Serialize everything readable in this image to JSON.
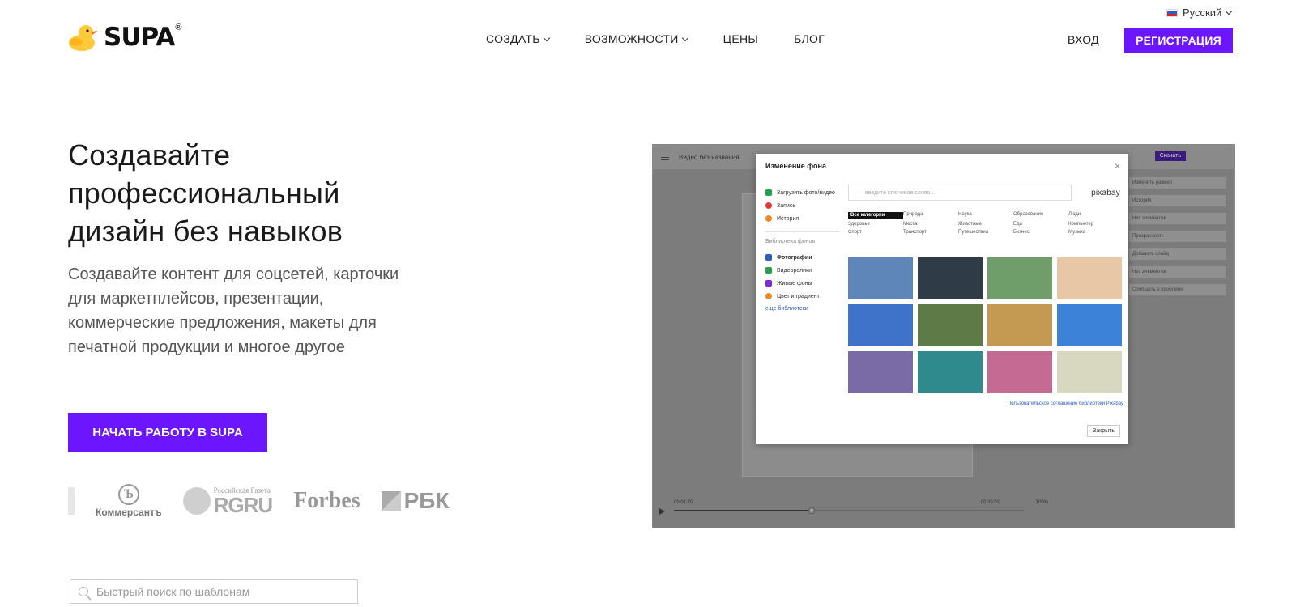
{
  "header": {
    "language": "Русский",
    "logo_text": "SUPA",
    "logo_reg": "®",
    "nav": [
      {
        "label": "СОЗДАТЬ",
        "dropdown": true
      },
      {
        "label": "ВОЗМОЖНОСТИ",
        "dropdown": true
      },
      {
        "label": "ЦЕНЫ",
        "dropdown": false
      },
      {
        "label": "БЛОГ",
        "dropdown": false
      }
    ],
    "login": "ВХОД",
    "register": "РЕГИСТРАЦИЯ"
  },
  "hero": {
    "title_lines": [
      "Создавайте",
      "профессиональный",
      "дизайн без навыков"
    ],
    "subtitle": "Создавайте контент для соцсетей, карточки для маркетплейсов, презентации, коммерческие предложения, макеты для печатной продукции и многое другое",
    "cta": "НАЧАТЬ РАБОТУ В SUPA"
  },
  "press": {
    "kommersant": "Коммерсантъ",
    "kommersant_mark": "Ъ",
    "rg_small": "Российская Газета",
    "rg_big": "RGRU",
    "forbes": "Forbes",
    "rbk": "РБК"
  },
  "search": {
    "placeholder": "Быстрый поиск по шаблонам"
  },
  "editor": {
    "doc_title": "Видео без названия",
    "download": "Скачать",
    "right_panel": [
      "Изменить размер",
      "История",
      "Нет элементов",
      "Прозрачность",
      "Добавить слайд",
      "Нет элементов",
      "Сообщить о проблеме"
    ],
    "time_start": "00:01:70",
    "time_end": "00:35:02",
    "volume": "100%",
    "modal": {
      "title": "Изменение фона",
      "close_x": "×",
      "actions": [
        {
          "label": "Загрузить фото/видео",
          "color": "#22a04b"
        },
        {
          "label": "Запись",
          "color": "#e53935"
        },
        {
          "label": "История",
          "color": "#f08a24"
        }
      ],
      "library_title": "Библиотека фонов",
      "library": [
        {
          "label": "Фотографии",
          "color": "#2a5fc4"
        },
        {
          "label": "Видеоролики",
          "color": "#22a04b"
        },
        {
          "label": "Живые фоны",
          "color": "#7b2bd6"
        },
        {
          "label": "Цвет и градиент",
          "color": "#f08a24"
        }
      ],
      "more_libraries": "еще библиотеки",
      "search_placeholder": "введите ключевое слово...",
      "provider": "pixabay",
      "categories": [
        "Все категории",
        "Природа",
        "Наука",
        "Образование",
        "Люди",
        "Здоровье",
        "Места",
        "Животные",
        "Еда",
        "Компьютер",
        "Спорт",
        "Транспорт",
        "Путешествия",
        "Бизнес",
        "Музыка"
      ],
      "thumbs": [
        "#5f86b8",
        "#2f3b47",
        "#6f9e6b",
        "#e8c7a5",
        "#3f73c9",
        "#5e7a46",
        "#c49a52",
        "#3b82d8",
        "#7a6aa6",
        "#2f8a8e",
        "#c46a93",
        "#d8d8c0"
      ],
      "terms": "Пользовательское соглашение библиотеки Pixabay",
      "close_button": "Закрыть"
    }
  }
}
